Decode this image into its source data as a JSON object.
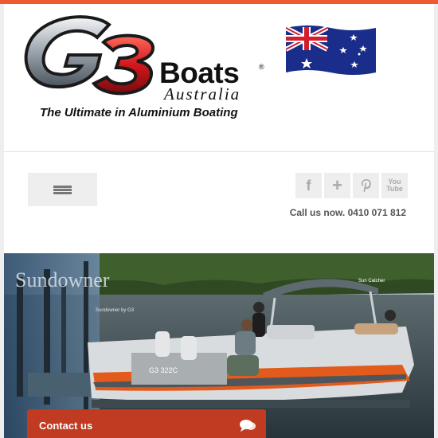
{
  "logo": {
    "mark": "G3",
    "brand": "Boats",
    "reg": "®",
    "sub": "Australia",
    "tagline": "The Ultimate in Aluminium Boating"
  },
  "header": {
    "flag_icon": "australian-flag-icon"
  },
  "nav": {
    "menu_icon": "hamburger-menu-icon"
  },
  "social": {
    "facebook": "f",
    "plus": "+",
    "pinterest": "P",
    "youtube_top": "You",
    "youtube_bottom": "Tube"
  },
  "contact_line": {
    "call_text": "Call us now. 0410 071 812"
  },
  "hero": {
    "overlay_title": "Sundowner",
    "overlay_sub": "Sundowner by G3",
    "boat_brand": "Sun Catcher",
    "hull_text": "G3 322C"
  },
  "contact_bar": {
    "label": "Contact us",
    "icon": "chat-bubble-icon"
  },
  "colors": {
    "accent": "#ee5a2d",
    "contact": "#c13a22",
    "page_bg": "#eeeeee"
  }
}
